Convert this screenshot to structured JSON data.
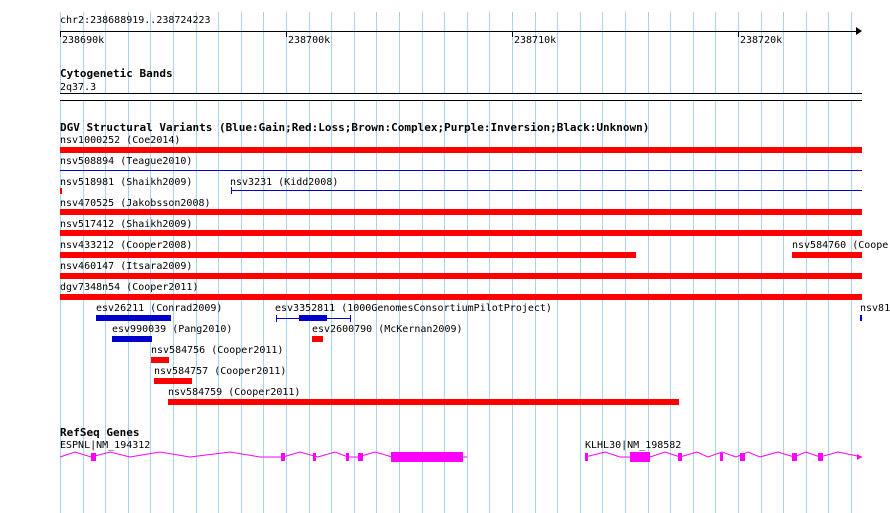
{
  "position_label": "chr2:238688919..238724223",
  "ruler_ticks": [
    "238690k",
    "238700k",
    "238710k",
    "238720k"
  ],
  "cyto": {
    "title": "Cytogenetic Bands",
    "band": "2q37.3"
  },
  "dgv": {
    "title": "DGV Structural Variants (Blue:Gain;Red:Loss;Brown:Complex;Purple:Inversion;Black:Unknown)",
    "features": [
      {
        "label": "nsv1000252 (Coe2014)",
        "color": "#ff0000"
      },
      {
        "label": "nsv508894 (Teague2010)",
        "color": "#0000cc"
      },
      {
        "label": "nsv518981 (Shaikh2009)",
        "color": "#ff0000"
      },
      {
        "label": "nsv3231 (Kidd2008)",
        "color": "#0000cc"
      },
      {
        "label": "nsv470525 (Jakobsson2008)",
        "color": "#ff0000"
      },
      {
        "label": "nsv517412 (Shaikh2009)",
        "color": "#ff0000"
      },
      {
        "label": "nsv433212 (Cooper2008)",
        "color": "#ff0000"
      },
      {
        "label": "nsv584760 (Cooper",
        "color": "#ff0000"
      },
      {
        "label": "nsv460147 (Itsara2009)",
        "color": "#ff0000"
      },
      {
        "label": "dgv7348n54 (Cooper2011)",
        "color": "#ff0000"
      },
      {
        "label": "esv26211 (Conrad2009)",
        "color": "#0000cc"
      },
      {
        "label": "esv3352811 (1000GenomesConsortiumPilotProject)",
        "color": "#0000cc"
      },
      {
        "label": "nsv81",
        "color": "#0000cc"
      },
      {
        "label": "esv990039 (Pang2010)",
        "color": "#0000cc"
      },
      {
        "label": "esv2600790 (McKernan2009)",
        "color": "#ff0000"
      },
      {
        "label": "nsv584756 (Cooper2011)",
        "color": "#ff0000"
      },
      {
        "label": "nsv584757 (Cooper2011)",
        "color": "#ff0000"
      },
      {
        "label": "nsv584759 (Cooper2011)",
        "color": "#ff0000"
      }
    ]
  },
  "refseq": {
    "title": "RefSeq Genes",
    "genes": [
      {
        "label": "ESPNL|NM_194312",
        "color": "#ff00ff"
      },
      {
        "label": "KLHL30|NM_198582",
        "color": "#ff00ff"
      }
    ]
  },
  "colors": {
    "grid": "#a9d3e8",
    "gain": "#0000cc",
    "loss": "#ff0000",
    "gene": "#ff00ff"
  }
}
